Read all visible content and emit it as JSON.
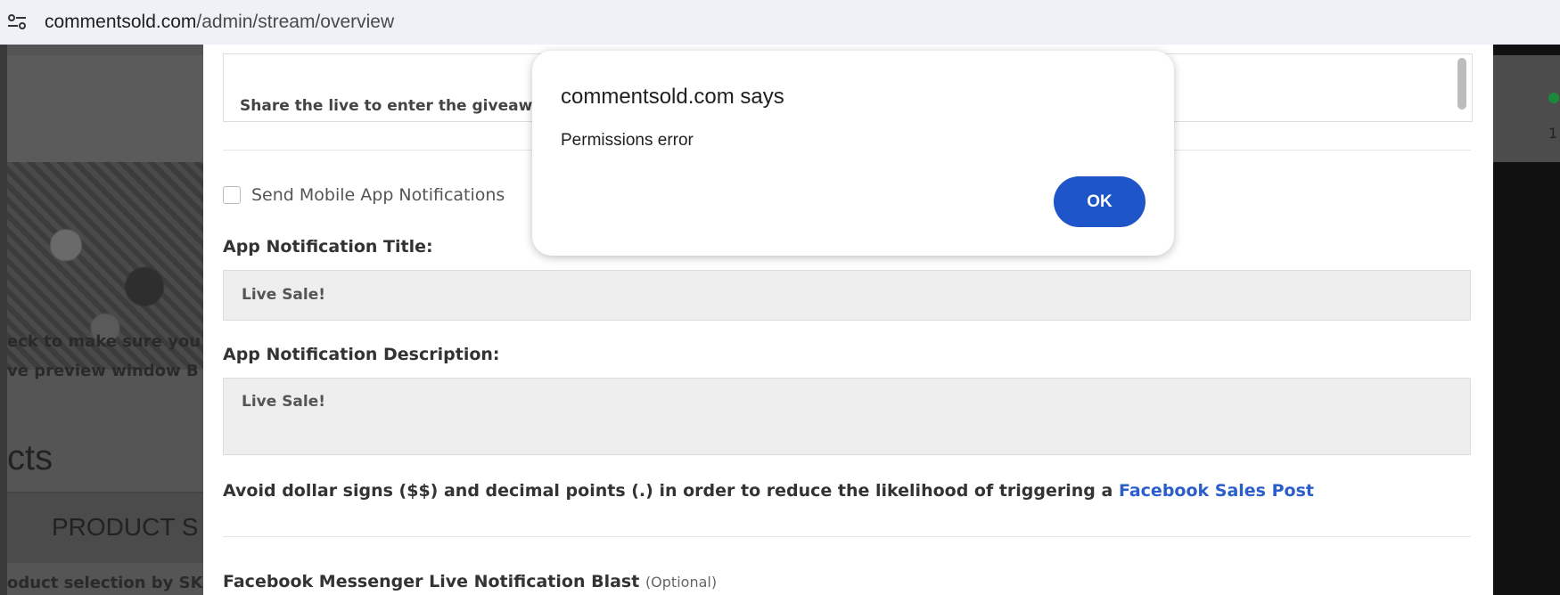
{
  "browser": {
    "url_host": "commentsold.com",
    "url_path": "/admin/stream/overview"
  },
  "background_left": {
    "line1": "eck to make sure you",
    "line2": "ve preview window B",
    "heading": "cts",
    "tab": "PRODUCT S",
    "bottom": "oduct selection by SK"
  },
  "background_right": {
    "number": "1"
  },
  "form": {
    "share_text": "Share the live to enter the giveaway",
    "send_mobile_label": "Send Mobile App Notifications",
    "app_title_label": "App Notification Title:",
    "app_title_value": "Live Sale!",
    "app_desc_label": "App Notification Description:",
    "app_desc_value": "Live Sale!",
    "avoid_text": "Avoid dollar signs ($$) and decimal points (.) in order to reduce the likelihood of triggering a",
    "avoid_link": "Facebook Sales Post",
    "messenger_label": "Facebook Messenger Live Notification Blast",
    "messenger_optional": "(Optional)"
  },
  "dialog": {
    "title": "commentsold.com says",
    "message": "Permissions error",
    "ok_label": "OK",
    "ok_color": "#1e55c8"
  }
}
